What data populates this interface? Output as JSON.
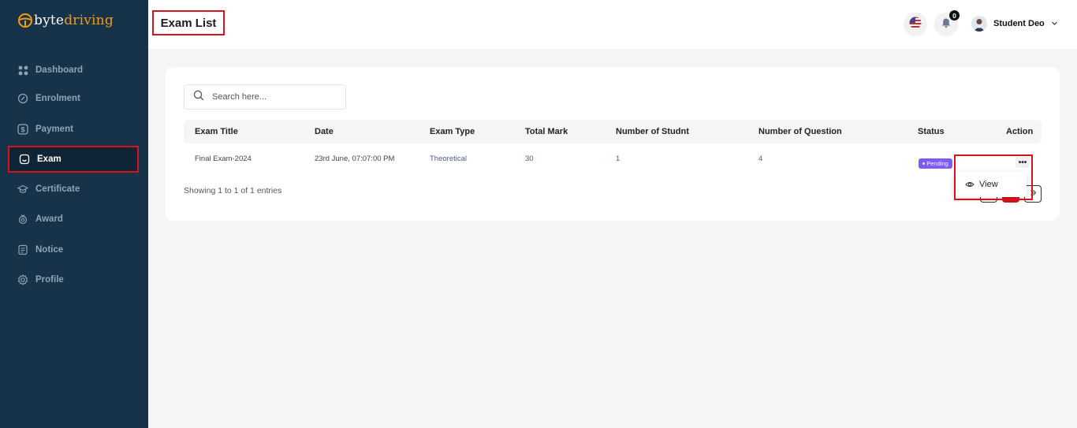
{
  "brand": {
    "part1": "byte",
    "part2": "driving"
  },
  "sidebar": {
    "items": [
      {
        "label": "Dashboard",
        "icon": "grid-icon"
      },
      {
        "label": "Enrolment",
        "icon": "tag-icon"
      },
      {
        "label": "Payment",
        "icon": "dollar-icon"
      },
      {
        "label": "Exam",
        "icon": "exam-icon"
      },
      {
        "label": "Certificate",
        "icon": "graduation-cap-icon"
      },
      {
        "label": "Award",
        "icon": "award-icon"
      },
      {
        "label": "Notice",
        "icon": "notice-icon"
      },
      {
        "label": "Profile",
        "icon": "gear-icon"
      }
    ]
  },
  "header": {
    "title": "Exam List",
    "notification_count": "0",
    "user_name": "Student Deo"
  },
  "search": {
    "placeholder": "Search here..."
  },
  "table": {
    "columns": [
      "Exam Title",
      "Date",
      "Exam Type",
      "Total Mark",
      "Number of Studnt",
      "Number of Question",
      "Status",
      "Action"
    ],
    "rows": [
      {
        "title": "Final Exam-2024",
        "date": "23rd June, 07:07:00 PM",
        "type": "Theoretical",
        "total_mark": "30",
        "students": "1",
        "questions": "4",
        "status": "Pending",
        "action": "•••"
      }
    ]
  },
  "footer": {
    "showing": "Showing 1 to 1 of 1 entries"
  },
  "dropdown": {
    "view_label": "View"
  },
  "colors": {
    "sidebar_bg": "#17334a",
    "accent": "#d6121a",
    "brand_orange": "#f39c12",
    "status_pending": "#7c5cf2"
  }
}
